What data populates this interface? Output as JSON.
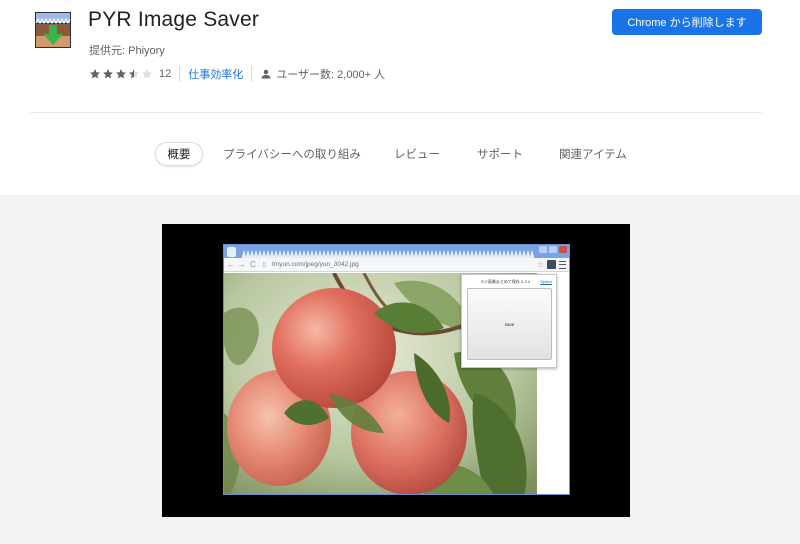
{
  "extension": {
    "title": "PYR Image Saver",
    "provider": "提供元: Phiyory",
    "rating": 3.5,
    "rating_count": "12",
    "category": "仕事効率化",
    "users": "ユーザー数: 2,000+ 人",
    "remove_button": "Chrome から削除します"
  },
  "tabs": [
    {
      "label": "概要",
      "active": true
    },
    {
      "label": "プライバシーへの取り組み",
      "active": false
    },
    {
      "label": "レビュー",
      "active": false
    },
    {
      "label": "サポート",
      "active": false
    },
    {
      "label": "関連アイテム",
      "active": false
    }
  ],
  "screenshot": {
    "address": "tmyun.com/jpeg/yun_3042.jpg",
    "popup_title": "ラジ画像まとめて保存 0.3.4",
    "popup_option": "Option",
    "popup_save": "save"
  },
  "colors": {
    "accent": "#1a73e8",
    "star_filled": "#5f6368",
    "star_empty": "#dadce0",
    "gallery_bg": "#f1f3f4"
  }
}
